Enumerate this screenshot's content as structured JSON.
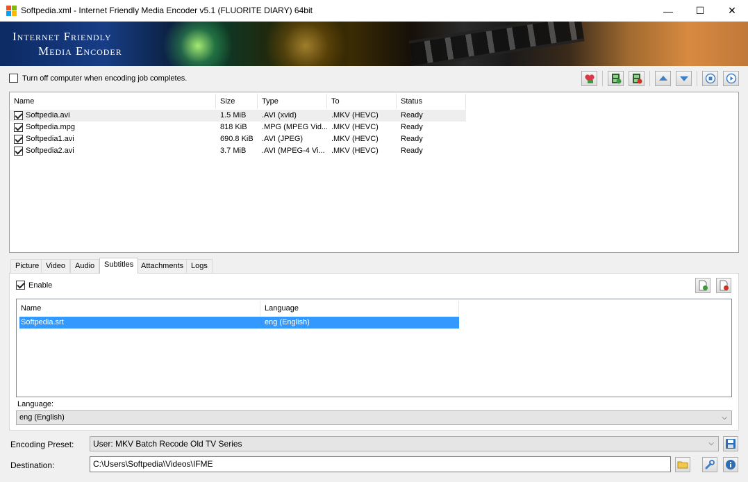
{
  "window": {
    "title": "Softpedia.xml - Internet Friendly Media Encoder v5.1 (FLUORITE DIARY) 64bit",
    "minimize": "—",
    "maximize": "☐",
    "close": "✕"
  },
  "banner": {
    "line1": "Internet Friendly",
    "line2": "Media Encoder"
  },
  "options": {
    "shutdown_label": "Turn off computer when encoding job completes.",
    "shutdown_checked": false
  },
  "toolbar": {
    "icons": [
      "add-job-icon",
      "add-video-icon",
      "remove-video-icon",
      "move-up-icon",
      "move-down-icon",
      "stop-icon",
      "start-icon"
    ]
  },
  "jobs": {
    "columns": [
      "Name",
      "Size",
      "Type",
      "To",
      "Status"
    ],
    "rows": [
      {
        "checked": true,
        "name": "Softpedia.avi",
        "size": "1.5 MiB",
        "type": ".AVI (xvid)",
        "to": ".MKV (HEVC)",
        "status": "Ready"
      },
      {
        "checked": true,
        "name": "Softpedia.mpg",
        "size": "818 KiB",
        "type": ".MPG (MPEG Vid...",
        "to": ".MKV (HEVC)",
        "status": "Ready"
      },
      {
        "checked": true,
        "name": "Softpedia1.avi",
        "size": "690.8 KiB",
        "type": ".AVI (JPEG)",
        "to": ".MKV (HEVC)",
        "status": "Ready"
      },
      {
        "checked": true,
        "name": "Softpedia2.avi",
        "size": "3.7 MiB",
        "type": ".AVI (MPEG-4 Vi...",
        "to": ".MKV (HEVC)",
        "status": "Ready"
      }
    ]
  },
  "tabs": {
    "items": [
      "Picture",
      "Video",
      "Audio",
      "Subtitles",
      "Attachments",
      "Logs"
    ],
    "active": "Subtitles"
  },
  "subtitles": {
    "enable_label": "Enable",
    "enable_checked": true,
    "columns": [
      "Name",
      "Language"
    ],
    "rows": [
      {
        "name": "Softpedia.srt",
        "language": "eng (English)",
        "selected": true
      }
    ],
    "language_label": "Language:",
    "language_value": "eng (English)"
  },
  "encoding": {
    "preset_label": "Encoding Preset:",
    "preset_value": "User: MKV Batch Recode Old TV Series",
    "destination_label": "Destination:",
    "destination_value": "C:\\Users\\Softpedia\\Videos\\IFME"
  },
  "colors": {
    "selection": "#3399ff",
    "toolbar_blue": "#3f7fc8",
    "toolbar_green": "#3b9a3b",
    "toolbar_red": "#cc3322"
  }
}
